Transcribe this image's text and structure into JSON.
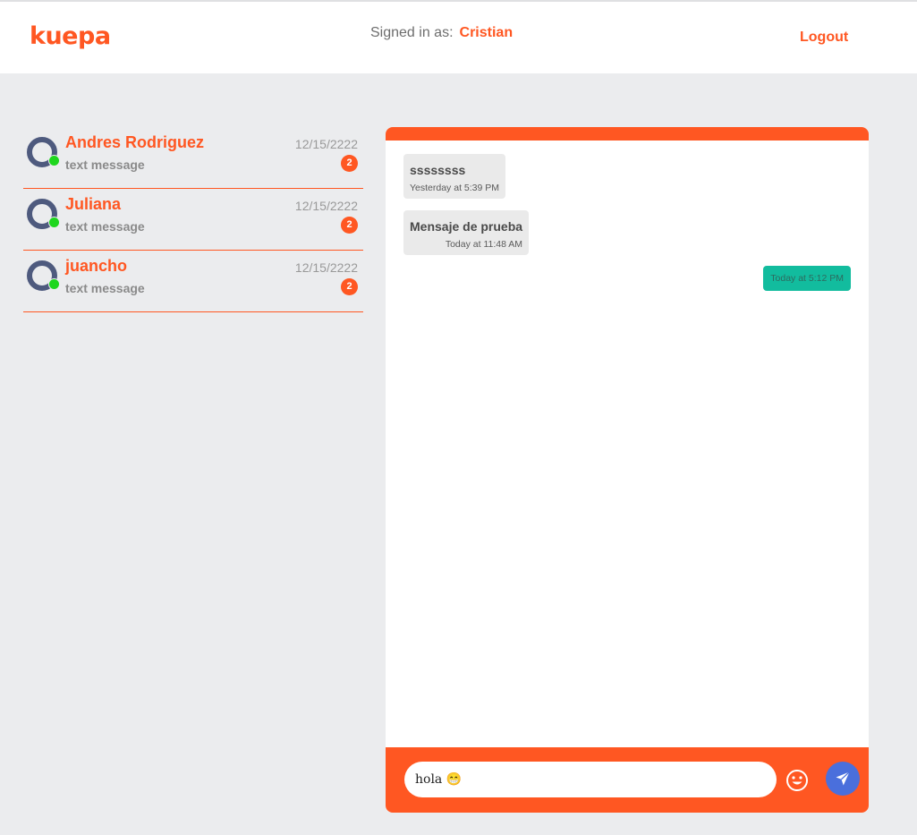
{
  "header": {
    "logo": "kuepa",
    "signed_in_label": "Signed in as:",
    "user_name": "Cristian",
    "logout_label": "Logout"
  },
  "contacts": [
    {
      "name": "Andres Rodriguez",
      "preview": "text message",
      "date": "12/15/2222",
      "unread": "2",
      "status": "online"
    },
    {
      "name": "Juliana",
      "preview": "text message",
      "date": "12/15/2222",
      "unread": "2",
      "status": "online"
    },
    {
      "name": "juancho",
      "preview": "text message",
      "date": "12/15/2222",
      "unread": "2",
      "status": "online"
    }
  ],
  "chat": {
    "messages": [
      {
        "direction": "incoming",
        "text": "ssssssss",
        "time": "Yesterday at 5:39 PM"
      },
      {
        "direction": "incoming",
        "text": "Mensaje de prueba",
        "time": "Today at 11:48 AM"
      },
      {
        "direction": "outgoing",
        "text": "",
        "time": "Today at 5:12 PM"
      }
    ],
    "composer": {
      "value": "hola 😁",
      "emoji_icon": "smiley-icon",
      "send_icon": "paper-plane-icon"
    }
  },
  "colors": {
    "accent": "#ff5722",
    "online": "#1ed61e",
    "outgoing_bubble": "#12bc9e",
    "send_button": "#4a6fdc",
    "background": "#ebecee"
  }
}
